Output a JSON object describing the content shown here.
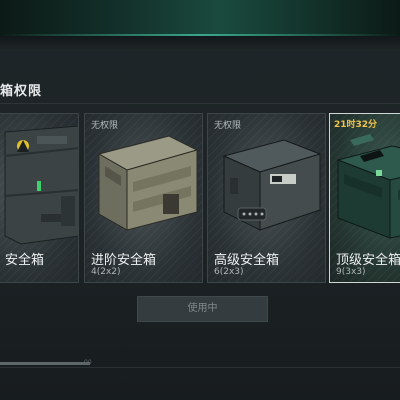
{
  "section": {
    "title": "箱权限"
  },
  "cases": [
    {
      "name": "安全箱",
      "size": "",
      "tag": "",
      "timer": "",
      "selected": false
    },
    {
      "name": "进阶安全箱",
      "size": "4(2x2)",
      "tag": "无权限",
      "timer": "",
      "selected": false
    },
    {
      "name": "高级安全箱",
      "size": "6(2x3)",
      "tag": "无权限",
      "timer": "",
      "selected": false
    },
    {
      "name": "顶级安全箱",
      "size": "9(3x3)",
      "tag": "",
      "timer": "21时32分",
      "selected": true
    }
  ],
  "use_button": {
    "label": "使用中"
  },
  "progress": {
    "label": "00",
    "fill_ratio": 0.22
  }
}
